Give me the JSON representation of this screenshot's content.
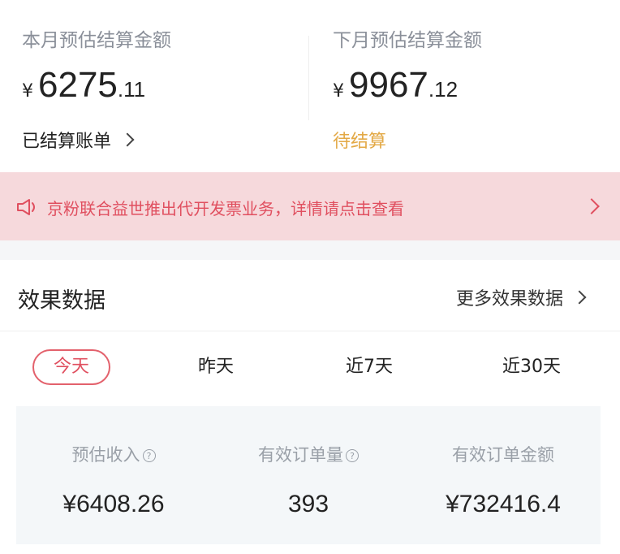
{
  "settlement": {
    "current_month": {
      "label": "本月预估结算金额",
      "currency": "¥",
      "amount_int": "6275",
      "amount_dec": ".11",
      "link_label": "已结算账单"
    },
    "next_month": {
      "label": "下月预估结算金额",
      "currency": "¥",
      "amount_int": "9967",
      "amount_dec": ".12",
      "status_label": "待结算"
    }
  },
  "notice": {
    "text": "京粉联合益世推出代开发票业务，详情请点击查看",
    "icon": "speaker-icon"
  },
  "effect": {
    "title": "效果数据",
    "more_label": "更多效果数据"
  },
  "tabs": [
    {
      "label": "今天",
      "active": true
    },
    {
      "label": "昨天",
      "active": false
    },
    {
      "label": "近7天",
      "active": false
    },
    {
      "label": "近30天",
      "active": false
    }
  ],
  "stats": [
    {
      "label": "预估收入",
      "value": "¥6408.26",
      "has_help": true
    },
    {
      "label": "有效订单量",
      "value": "393",
      "has_help": true
    },
    {
      "label": "有效订单金额",
      "value": "¥732416.4",
      "has_help": false
    }
  ],
  "colors": {
    "accent": "#e04f5f",
    "pending": "#e3a946",
    "notice_bg": "#f6d9dc"
  }
}
